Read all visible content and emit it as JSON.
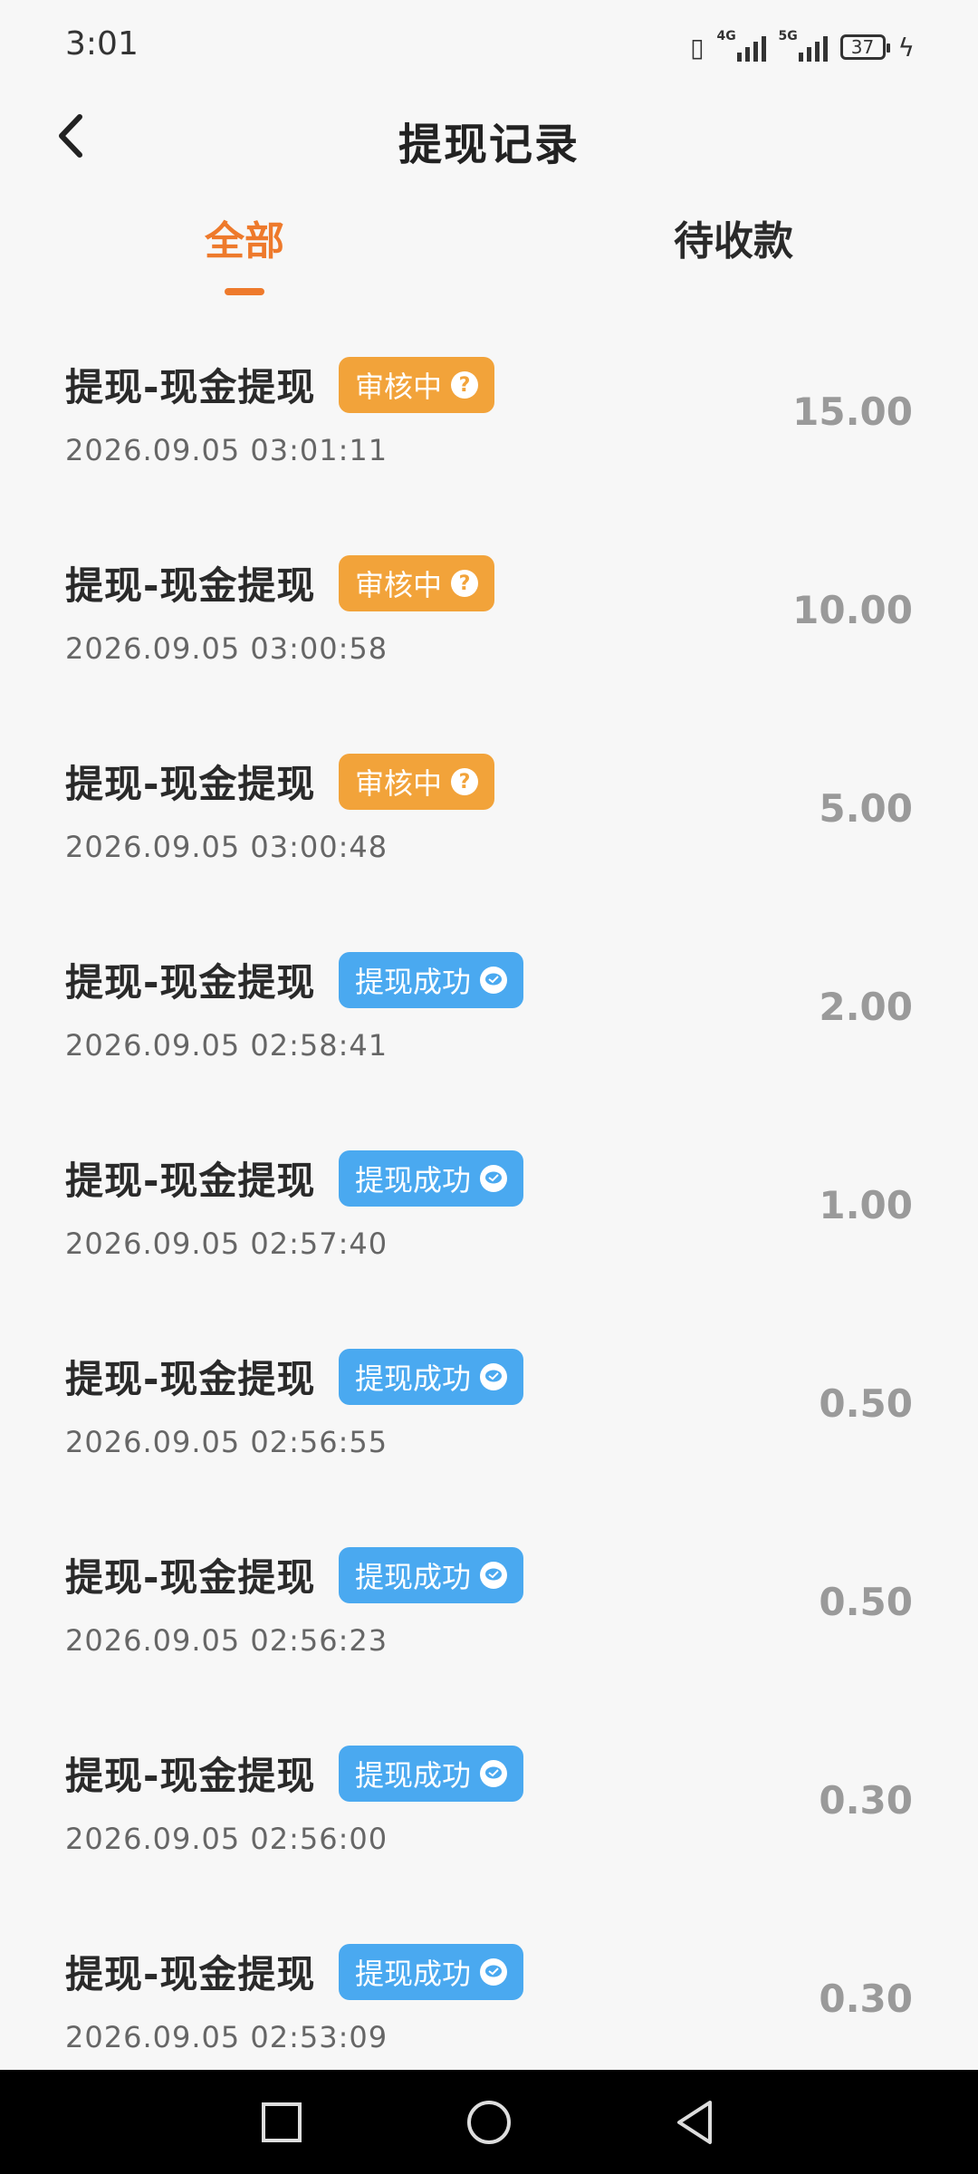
{
  "status_bar": {
    "time": "3:01",
    "network1": "4G",
    "network2": "5G",
    "battery": "37"
  },
  "header": {
    "title": "提现记录"
  },
  "tabs": [
    {
      "label": "全部",
      "active": true
    },
    {
      "label": "待收款",
      "active": false
    }
  ],
  "colors": {
    "accent": "#ee7a2c",
    "review_badge": "#f2a33a",
    "success_badge": "#4aa9f0"
  },
  "records": [
    {
      "title": "提现-现金提现",
      "status": "审核中",
      "status_type": "review",
      "time": "2026.09.05 03:01:11",
      "amount": "15.00"
    },
    {
      "title": "提现-现金提现",
      "status": "审核中",
      "status_type": "review",
      "time": "2026.09.05 03:00:58",
      "amount": "10.00"
    },
    {
      "title": "提现-现金提现",
      "status": "审核中",
      "status_type": "review",
      "time": "2026.09.05 03:00:48",
      "amount": "5.00"
    },
    {
      "title": "提现-现金提现",
      "status": "提现成功",
      "status_type": "success",
      "time": "2026.09.05 02:58:41",
      "amount": "2.00"
    },
    {
      "title": "提现-现金提现",
      "status": "提现成功",
      "status_type": "success",
      "time": "2026.09.05 02:57:40",
      "amount": "1.00"
    },
    {
      "title": "提现-现金提现",
      "status": "提现成功",
      "status_type": "success",
      "time": "2026.09.05 02:56:55",
      "amount": "0.50"
    },
    {
      "title": "提现-现金提现",
      "status": "提现成功",
      "status_type": "success",
      "time": "2026.09.05 02:56:23",
      "amount": "0.50"
    },
    {
      "title": "提现-现金提现",
      "status": "提现成功",
      "status_type": "success",
      "time": "2026.09.05 02:56:00",
      "amount": "0.30"
    },
    {
      "title": "提现-现金提现",
      "status": "提现成功",
      "status_type": "success",
      "time": "2026.09.05 02:53:09",
      "amount": "0.30"
    }
  ],
  "icons": {
    "back": "chevron-left-icon",
    "review": "question-circle-icon",
    "success": "wechat-bubble-icon"
  }
}
